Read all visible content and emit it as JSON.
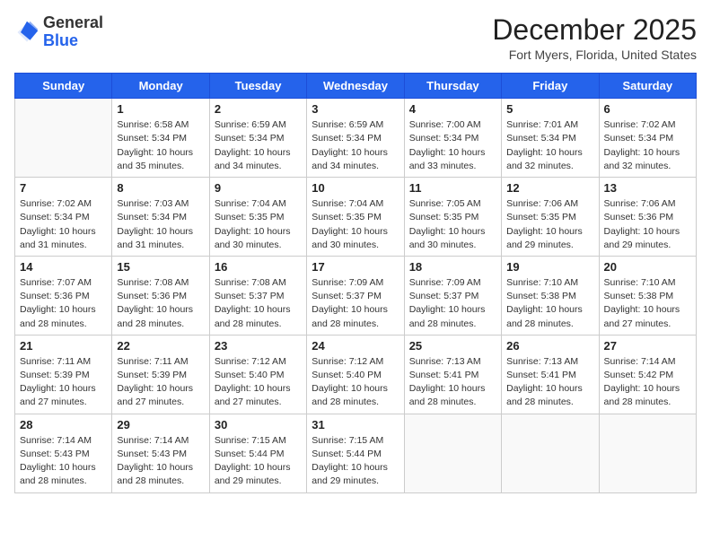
{
  "logo": {
    "general": "General",
    "blue": "Blue"
  },
  "title": {
    "month_year": "December 2025",
    "location": "Fort Myers, Florida, United States"
  },
  "days_of_week": [
    "Sunday",
    "Monday",
    "Tuesday",
    "Wednesday",
    "Thursday",
    "Friday",
    "Saturday"
  ],
  "weeks": [
    [
      {
        "num": "",
        "info": ""
      },
      {
        "num": "1",
        "info": "Sunrise: 6:58 AM\nSunset: 5:34 PM\nDaylight: 10 hours\nand 35 minutes."
      },
      {
        "num": "2",
        "info": "Sunrise: 6:59 AM\nSunset: 5:34 PM\nDaylight: 10 hours\nand 34 minutes."
      },
      {
        "num": "3",
        "info": "Sunrise: 6:59 AM\nSunset: 5:34 PM\nDaylight: 10 hours\nand 34 minutes."
      },
      {
        "num": "4",
        "info": "Sunrise: 7:00 AM\nSunset: 5:34 PM\nDaylight: 10 hours\nand 33 minutes."
      },
      {
        "num": "5",
        "info": "Sunrise: 7:01 AM\nSunset: 5:34 PM\nDaylight: 10 hours\nand 32 minutes."
      },
      {
        "num": "6",
        "info": "Sunrise: 7:02 AM\nSunset: 5:34 PM\nDaylight: 10 hours\nand 32 minutes."
      }
    ],
    [
      {
        "num": "7",
        "info": "Sunrise: 7:02 AM\nSunset: 5:34 PM\nDaylight: 10 hours\nand 31 minutes."
      },
      {
        "num": "8",
        "info": "Sunrise: 7:03 AM\nSunset: 5:34 PM\nDaylight: 10 hours\nand 31 minutes."
      },
      {
        "num": "9",
        "info": "Sunrise: 7:04 AM\nSunset: 5:35 PM\nDaylight: 10 hours\nand 30 minutes."
      },
      {
        "num": "10",
        "info": "Sunrise: 7:04 AM\nSunset: 5:35 PM\nDaylight: 10 hours\nand 30 minutes."
      },
      {
        "num": "11",
        "info": "Sunrise: 7:05 AM\nSunset: 5:35 PM\nDaylight: 10 hours\nand 30 minutes."
      },
      {
        "num": "12",
        "info": "Sunrise: 7:06 AM\nSunset: 5:35 PM\nDaylight: 10 hours\nand 29 minutes."
      },
      {
        "num": "13",
        "info": "Sunrise: 7:06 AM\nSunset: 5:36 PM\nDaylight: 10 hours\nand 29 minutes."
      }
    ],
    [
      {
        "num": "14",
        "info": "Sunrise: 7:07 AM\nSunset: 5:36 PM\nDaylight: 10 hours\nand 28 minutes."
      },
      {
        "num": "15",
        "info": "Sunrise: 7:08 AM\nSunset: 5:36 PM\nDaylight: 10 hours\nand 28 minutes."
      },
      {
        "num": "16",
        "info": "Sunrise: 7:08 AM\nSunset: 5:37 PM\nDaylight: 10 hours\nand 28 minutes."
      },
      {
        "num": "17",
        "info": "Sunrise: 7:09 AM\nSunset: 5:37 PM\nDaylight: 10 hours\nand 28 minutes."
      },
      {
        "num": "18",
        "info": "Sunrise: 7:09 AM\nSunset: 5:37 PM\nDaylight: 10 hours\nand 28 minutes."
      },
      {
        "num": "19",
        "info": "Sunrise: 7:10 AM\nSunset: 5:38 PM\nDaylight: 10 hours\nand 28 minutes."
      },
      {
        "num": "20",
        "info": "Sunrise: 7:10 AM\nSunset: 5:38 PM\nDaylight: 10 hours\nand 27 minutes."
      }
    ],
    [
      {
        "num": "21",
        "info": "Sunrise: 7:11 AM\nSunset: 5:39 PM\nDaylight: 10 hours\nand 27 minutes."
      },
      {
        "num": "22",
        "info": "Sunrise: 7:11 AM\nSunset: 5:39 PM\nDaylight: 10 hours\nand 27 minutes."
      },
      {
        "num": "23",
        "info": "Sunrise: 7:12 AM\nSunset: 5:40 PM\nDaylight: 10 hours\nand 27 minutes."
      },
      {
        "num": "24",
        "info": "Sunrise: 7:12 AM\nSunset: 5:40 PM\nDaylight: 10 hours\nand 28 minutes."
      },
      {
        "num": "25",
        "info": "Sunrise: 7:13 AM\nSunset: 5:41 PM\nDaylight: 10 hours\nand 28 minutes."
      },
      {
        "num": "26",
        "info": "Sunrise: 7:13 AM\nSunset: 5:41 PM\nDaylight: 10 hours\nand 28 minutes."
      },
      {
        "num": "27",
        "info": "Sunrise: 7:14 AM\nSunset: 5:42 PM\nDaylight: 10 hours\nand 28 minutes."
      }
    ],
    [
      {
        "num": "28",
        "info": "Sunrise: 7:14 AM\nSunset: 5:43 PM\nDaylight: 10 hours\nand 28 minutes."
      },
      {
        "num": "29",
        "info": "Sunrise: 7:14 AM\nSunset: 5:43 PM\nDaylight: 10 hours\nand 28 minutes."
      },
      {
        "num": "30",
        "info": "Sunrise: 7:15 AM\nSunset: 5:44 PM\nDaylight: 10 hours\nand 29 minutes."
      },
      {
        "num": "31",
        "info": "Sunrise: 7:15 AM\nSunset: 5:44 PM\nDaylight: 10 hours\nand 29 minutes."
      },
      {
        "num": "",
        "info": ""
      },
      {
        "num": "",
        "info": ""
      },
      {
        "num": "",
        "info": ""
      }
    ]
  ]
}
